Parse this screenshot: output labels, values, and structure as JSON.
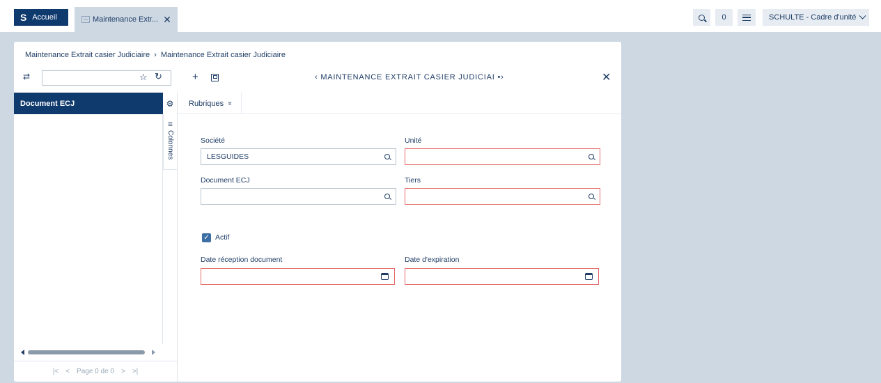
{
  "topbar": {
    "home_logo": "S",
    "home_label": "Accueil",
    "tab_label": "Maintenance Extr...",
    "tab_close": "✕",
    "count": "0",
    "user": "SCHULTE - Cadre d'unité"
  },
  "breadcrumb": {
    "item1": "Maintenance Extrait casier Judiciaire",
    "sep": "›",
    "item2": "Maintenance Extrait casier Judiciaire"
  },
  "list": {
    "search_value": "",
    "header": "Document ECJ",
    "columns_label": "Colonnes",
    "pager": {
      "first": "|<",
      "prev": "<",
      "text": "Page 0 de 0",
      "next": ">",
      "last": ">|"
    }
  },
  "form": {
    "plus": "+",
    "title": "‹ MAINTENANCE EXTRAIT CASIER JUDICIAI  •›",
    "close": "✕",
    "tab_label": "Rubriques",
    "tab_chevron": "»",
    "fields": {
      "societe_label": "Société",
      "societe_value": "LESGUIDES",
      "unite_label": "Unité",
      "unite_value": "",
      "document_label": "Document ECJ",
      "document_value": "",
      "tiers_label": "Tiers",
      "tiers_value": "",
      "actif_label": "Actif",
      "actif_checked": true,
      "date_reception_label": "Date réception document",
      "date_reception_value": "",
      "date_expiration_label": "Date d'expiration",
      "date_expiration_value": ""
    }
  },
  "colors": {
    "brand": "#0f3a6e",
    "background": "#cdd8e3",
    "required_border": "#e46b6b",
    "text": "#1f3d66"
  },
  "icons": [
    "search-icon",
    "hamburger-menu-icon",
    "chevron-down-icon",
    "sync-icon",
    "star-icon",
    "refresh-icon",
    "gear-icon",
    "columns-icon",
    "plus-icon",
    "save-icon",
    "close-icon",
    "calendar-icon",
    "checkbox-checked-icon"
  ]
}
